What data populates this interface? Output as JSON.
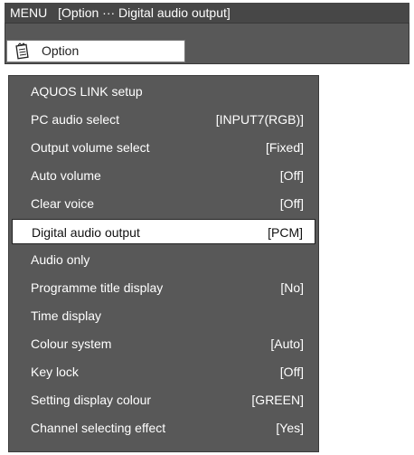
{
  "header": {
    "menu_label": "MENU",
    "breadcrumb": "[Option ··· Digital audio output]"
  },
  "tab": {
    "label": "Option",
    "icon": "notepad-icon"
  },
  "menu_items": [
    {
      "label": "AQUOS LINK setup",
      "value": ""
    },
    {
      "label": "PC audio select",
      "value": "[INPUT7(RGB)]"
    },
    {
      "label": "Output volume select",
      "value": "[Fixed]"
    },
    {
      "label": "Auto volume",
      "value": "[Off]"
    },
    {
      "label": "Clear voice",
      "value": "[Off]"
    },
    {
      "label": "Digital audio output",
      "value": "[PCM]"
    },
    {
      "label": "Audio only",
      "value": ""
    },
    {
      "label": "Programme title display",
      "value": "[No]"
    },
    {
      "label": "Time display",
      "value": ""
    },
    {
      "label": "Colour system",
      "value": "[Auto]"
    },
    {
      "label": "Key lock",
      "value": "[Off]"
    },
    {
      "label": "Setting display colour",
      "value": "[GREEN]"
    },
    {
      "label": "Channel selecting effect",
      "value": "[Yes]"
    }
  ],
  "selected_index": 5,
  "colors": {
    "bar": "#474747",
    "panel": "#585858",
    "highlight": "#ffffff"
  }
}
